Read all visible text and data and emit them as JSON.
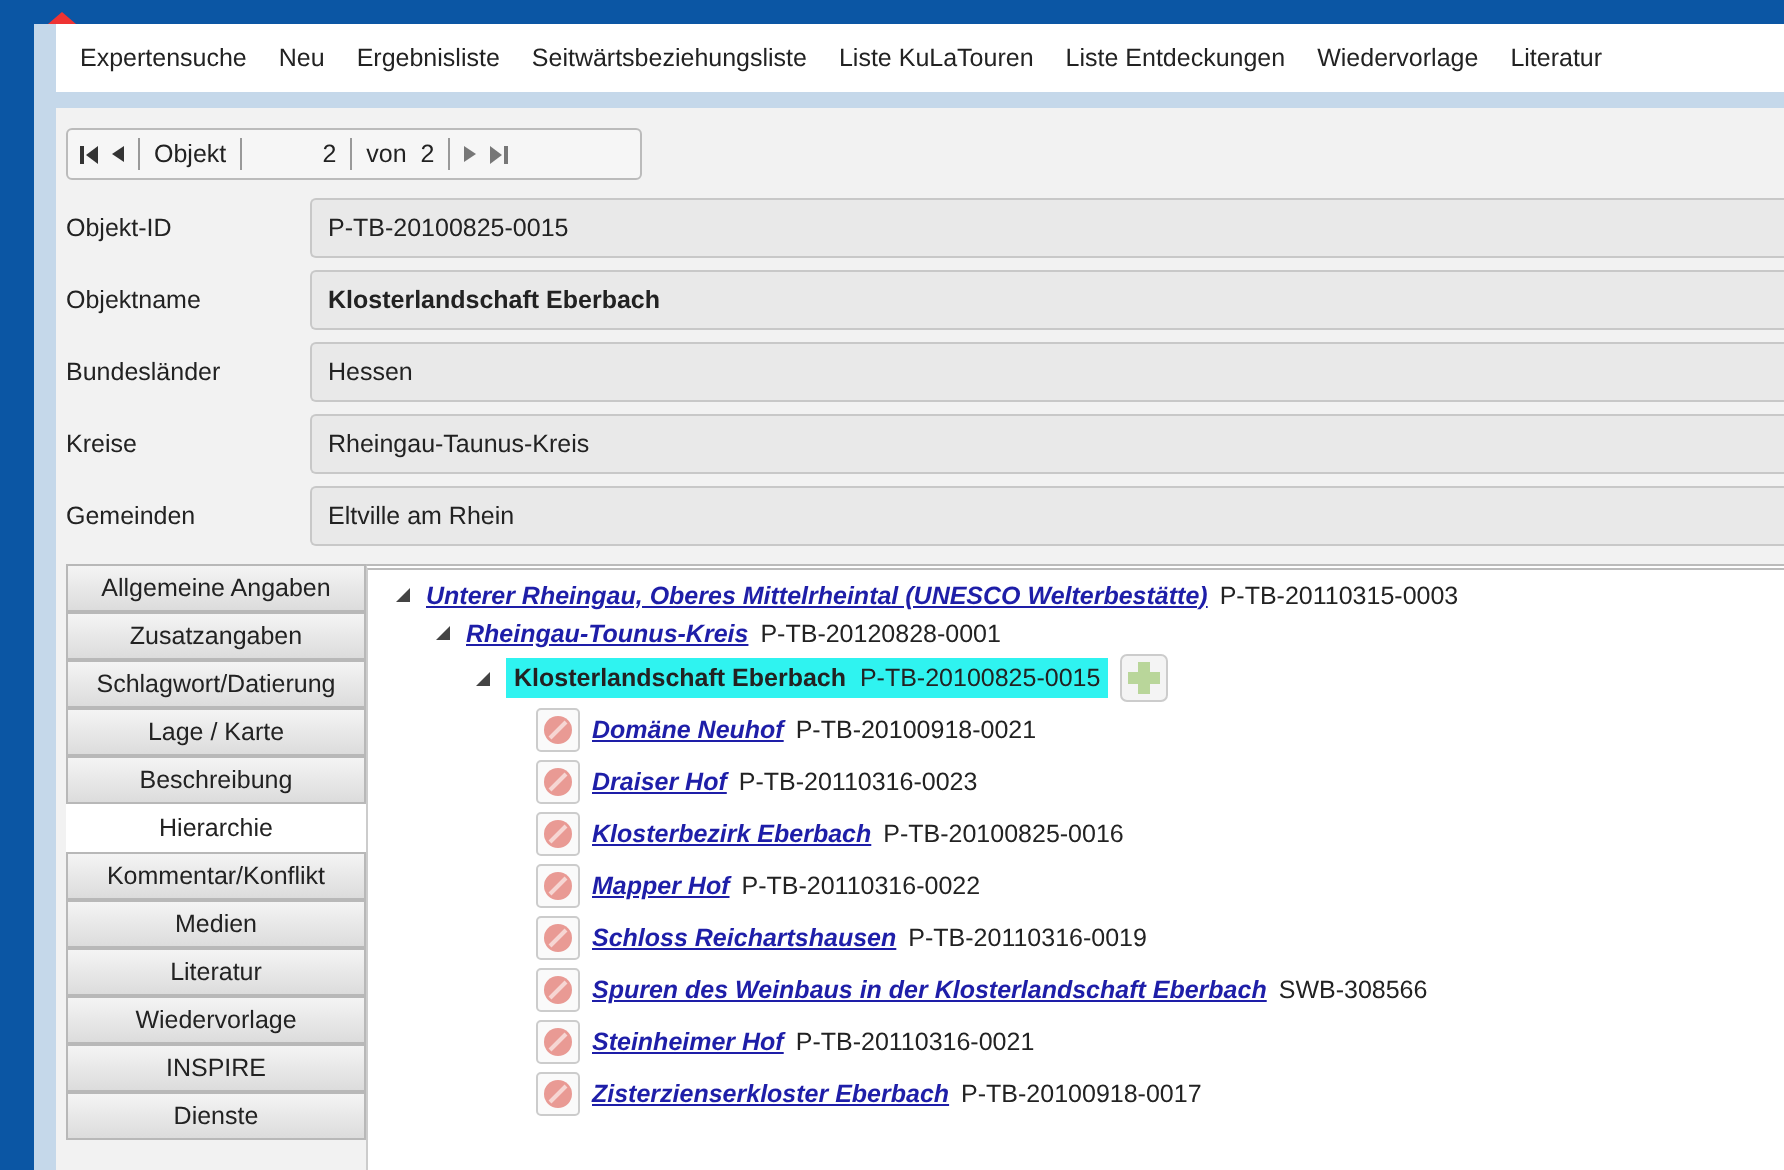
{
  "menu": [
    "Expertensuche",
    "Neu",
    "Ergebnisliste",
    "Seitwärtsbeziehungsliste",
    "Liste KuLaTouren",
    "Liste Entdeckungen",
    "Wiedervorlage",
    "Literatur"
  ],
  "navigator": {
    "label": "Objekt",
    "value": "2",
    "of": "von",
    "total": "2"
  },
  "fields": [
    {
      "label": "Objekt-ID",
      "value": "P-TB-20100825-0015",
      "bold": false
    },
    {
      "label": "Objektname",
      "value": "Klosterlandschaft Eberbach",
      "bold": true
    },
    {
      "label": "Bundesländer",
      "value": "Hessen",
      "bold": false
    },
    {
      "label": "Kreise",
      "value": "Rheingau-Taunus-Kreis",
      "bold": false
    },
    {
      "label": "Gemeinden",
      "value": "Eltville am Rhein",
      "bold": false
    }
  ],
  "tabs": [
    {
      "label": "Allgemeine Angaben",
      "selected": false
    },
    {
      "label": "Zusatzangaben",
      "selected": false
    },
    {
      "label": "Schlagwort/Datierung",
      "selected": false
    },
    {
      "label": "Lage / Karte",
      "selected": false
    },
    {
      "label": "Beschreibung",
      "selected": false
    },
    {
      "label": "Hierarchie",
      "selected": true
    },
    {
      "label": "Kommentar/Konflikt",
      "selected": false
    },
    {
      "label": "Medien",
      "selected": false
    },
    {
      "label": "Literatur",
      "selected": false
    },
    {
      "label": "Wiedervorlage",
      "selected": false
    },
    {
      "label": "INSPIRE",
      "selected": false
    },
    {
      "label": "Dienste",
      "selected": false
    }
  ],
  "tree": [
    {
      "label": "Unterer Rheingau, Oberes Mittelrheintal (UNESCO Welterbestätte)",
      "id": "P-TB-20110315-0003",
      "selected": false,
      "expanded": true,
      "children": [
        {
          "label": "Rheingau-Tounus-Kreis",
          "id": "P-TB-20120828-0001",
          "selected": false,
          "expanded": true,
          "children": [
            {
              "label": "Klosterlandschaft Eberbach",
              "id": "P-TB-20100825-0015",
              "selected": true,
              "expanded": true,
              "children": [
                {
                  "label": "Domäne Neuhof",
                  "id": "P-TB-20100918-0021",
                  "selected": false
                },
                {
                  "label": "Draiser Hof",
                  "id": "P-TB-20110316-0023",
                  "selected": false
                },
                {
                  "label": "Klosterbezirk Eberbach",
                  "id": "P-TB-20100825-0016",
                  "selected": false
                },
                {
                  "label": "Mapper Hof",
                  "id": "P-TB-20110316-0022",
                  "selected": false
                },
                {
                  "label": "Schloss Reichartshausen",
                  "id": "P-TB-20110316-0019",
                  "selected": false
                },
                {
                  "label": "Spuren des Weinbaus in der Klosterlandschaft Eberbach",
                  "id": "SWB-308566",
                  "selected": false
                },
                {
                  "label": "Steinheimer Hof",
                  "id": "P-TB-20110316-0021",
                  "selected": false
                },
                {
                  "label": "Zisterzienserkloster Eberbach",
                  "id": "P-TB-20100918-0017",
                  "selected": false
                }
              ]
            }
          ]
        }
      ]
    }
  ]
}
